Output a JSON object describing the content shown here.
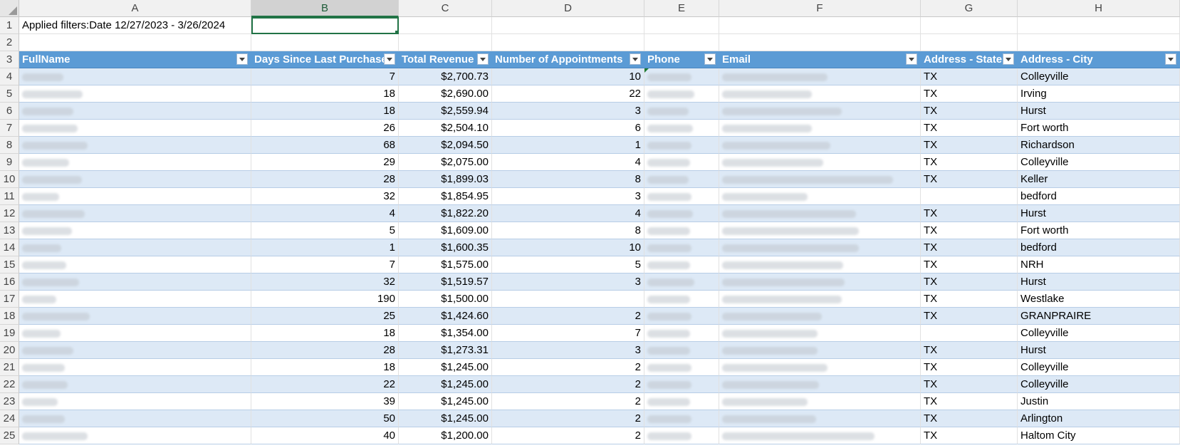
{
  "columns": [
    "A",
    "B",
    "C",
    "D",
    "E",
    "F",
    "G",
    "H"
  ],
  "filter_text": "Applied filters:Date 12/27/2023 - 3/26/2024",
  "headers": [
    "FullName",
    "Days Since Last Purchase",
    "Total Revenue",
    "Number of Appointments",
    "Phone",
    "Email",
    "Address - State",
    "Address - City"
  ],
  "rows": [
    {
      "days": "7",
      "rev": "$2,700.73",
      "appt": "10",
      "state": "TX",
      "city": "Colleyville"
    },
    {
      "days": "18",
      "rev": "$2,690.00",
      "appt": "22",
      "state": "TX",
      "city": "Irving"
    },
    {
      "days": "18",
      "rev": "$2,559.94",
      "appt": "3",
      "state": "TX",
      "city": "Hurst"
    },
    {
      "days": "26",
      "rev": "$2,504.10",
      "appt": "6",
      "state": "TX",
      "city": "Fort worth"
    },
    {
      "days": "68",
      "rev": "$2,094.50",
      "appt": "1",
      "state": "TX",
      "city": "Richardson"
    },
    {
      "days": "29",
      "rev": "$2,075.00",
      "appt": "4",
      "state": "TX",
      "city": "Colleyville"
    },
    {
      "days": "28",
      "rev": "$1,899.03",
      "appt": "8",
      "state": "TX",
      "city": "Keller"
    },
    {
      "days": "32",
      "rev": "$1,854.95",
      "appt": "3",
      "state": "",
      "city": "bedford"
    },
    {
      "days": "4",
      "rev": "$1,822.20",
      "appt": "4",
      "state": "TX",
      "city": "Hurst"
    },
    {
      "days": "5",
      "rev": "$1,609.00",
      "appt": "8",
      "state": "TX",
      "city": "Fort worth"
    },
    {
      "days": "1",
      "rev": "$1,600.35",
      "appt": "10",
      "state": "TX",
      "city": "bedford"
    },
    {
      "days": "7",
      "rev": "$1,575.00",
      "appt": "5",
      "state": "TX",
      "city": "NRH"
    },
    {
      "days": "32",
      "rev": "$1,519.57",
      "appt": "3",
      "state": "TX",
      "city": "Hurst"
    },
    {
      "days": "190",
      "rev": "$1,500.00",
      "appt": "",
      "state": "TX",
      "city": "Westlake"
    },
    {
      "days": "25",
      "rev": "$1,424.60",
      "appt": "2",
      "state": "TX",
      "city": "GRANPRAIRE"
    },
    {
      "days": "18",
      "rev": "$1,354.00",
      "appt": "7",
      "state": "",
      "city": "Colleyville"
    },
    {
      "days": "28",
      "rev": "$1,273.31",
      "appt": "3",
      "state": "TX",
      "city": "Hurst"
    },
    {
      "days": "18",
      "rev": "$1,245.00",
      "appt": "2",
      "state": "TX",
      "city": "Colleyville"
    },
    {
      "days": "22",
      "rev": "$1,245.00",
      "appt": "2",
      "state": "TX",
      "city": "Colleyville"
    },
    {
      "days": "39",
      "rev": "$1,245.00",
      "appt": "2",
      "state": "TX",
      "city": "Justin"
    },
    {
      "days": "50",
      "rev": "$1,245.00",
      "appt": "2",
      "state": "TX",
      "city": "Arlington"
    },
    {
      "days": "40",
      "rev": "$1,200.00",
      "appt": "2",
      "state": "TX",
      "city": "Haltom City"
    }
  ]
}
